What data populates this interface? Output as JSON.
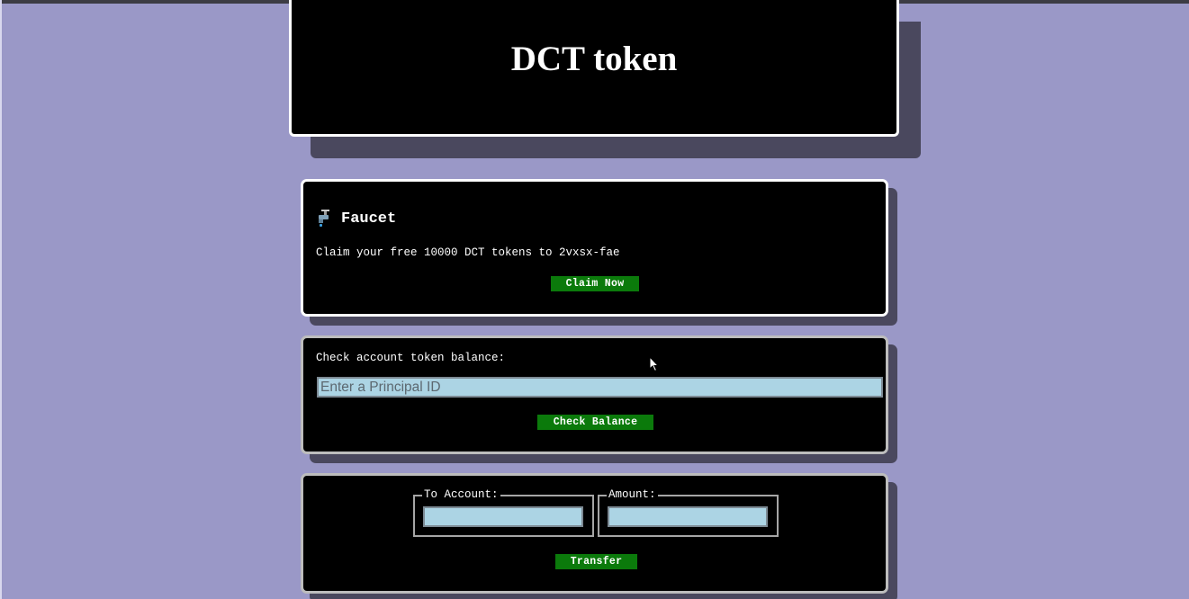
{
  "header": {
    "title": "DCT token"
  },
  "faucet": {
    "icon": "faucet-icon",
    "title": "Faucet",
    "description": "Claim your free 10000 DCT tokens to 2vxsx-fae",
    "button_label": "Claim Now"
  },
  "balance": {
    "label": "Check account token balance:",
    "input_placeholder": "Enter a Principal ID",
    "input_value": "",
    "button_label": "Check Balance"
  },
  "transfer": {
    "to_account_label": "To Account:",
    "to_account_value": "",
    "amount_label": "Amount:",
    "amount_value": "",
    "button_label": "Transfer"
  },
  "colors": {
    "background": "#9a98c7",
    "card": "#000000",
    "button": "#0b7a0b",
    "input": "#acd4e4"
  }
}
